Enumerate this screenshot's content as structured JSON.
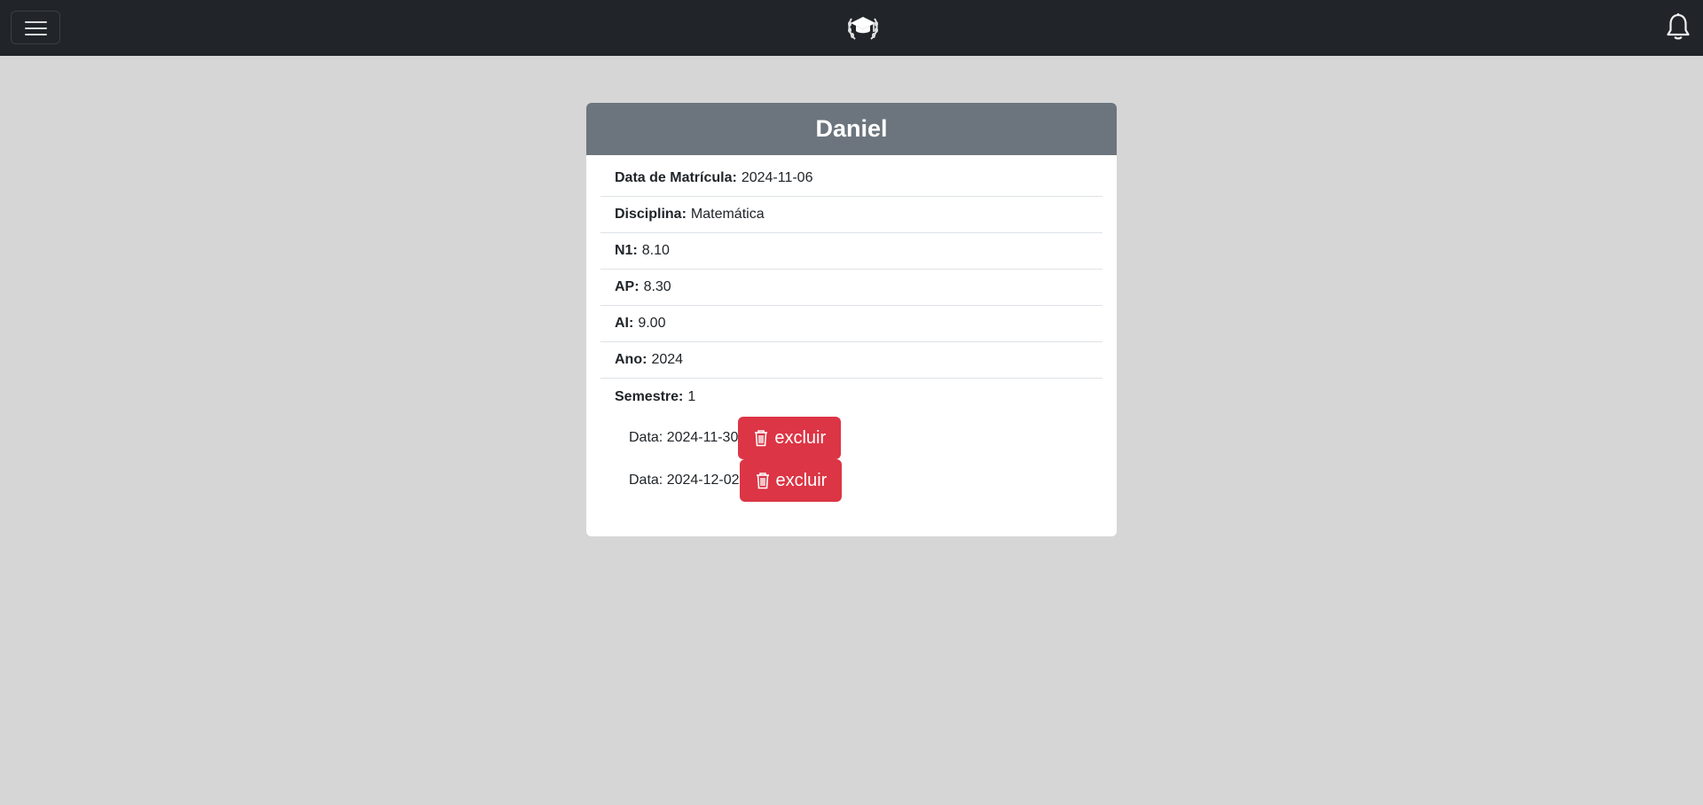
{
  "student": {
    "name": "Daniel"
  },
  "fields": [
    {
      "label": "Data de Matrícula:",
      "value": "2024-11-06"
    },
    {
      "label": "Disciplina:",
      "value": "Matemática"
    },
    {
      "label": "N1:",
      "value": "8.10"
    },
    {
      "label": "AP:",
      "value": "8.30"
    },
    {
      "label": "AI:",
      "value": "9.00"
    },
    {
      "label": "Ano:",
      "value": "2024"
    },
    {
      "label": "Semestre:",
      "value": "1"
    }
  ],
  "dates": [
    {
      "text": "Data: 2024-11-30",
      "button": "excluir"
    },
    {
      "text": "Data: 2024-12-02",
      "button": "excluir"
    }
  ],
  "icons": {
    "menu": "hamburger-menu-icon",
    "logo": "graduation-cap-laurel-icon",
    "notifications": "bell-icon",
    "delete": "trash-icon"
  },
  "colors": {
    "navbar": "#212529",
    "card_header": "#6c757d",
    "danger": "#dc3545",
    "background": "#d6d6d6"
  }
}
